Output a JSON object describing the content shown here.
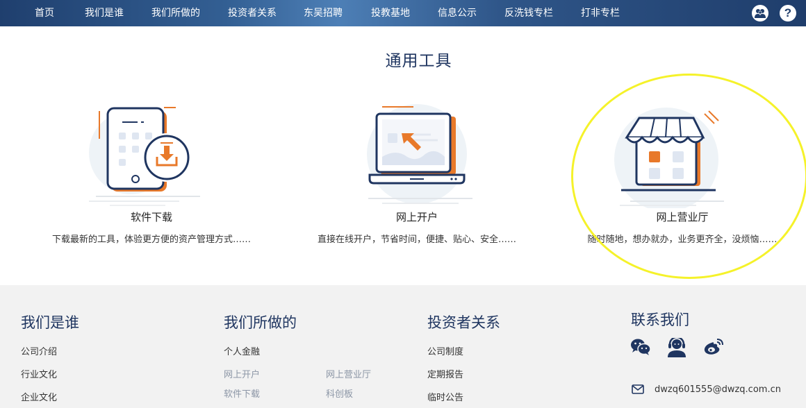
{
  "nav": {
    "items": [
      "首页",
      "我们是谁",
      "我们所做的",
      "投资者关系",
      "东吴招聘",
      "投教基地",
      "信息公示",
      "反洗钱专栏",
      "打非专栏"
    ],
    "user_icon": "user-group-icon",
    "help_icon": "help-icon",
    "help_glyph": "?"
  },
  "tools": {
    "title": "通用工具",
    "items": [
      {
        "name": "软件下载",
        "desc": "下载最新的工具，体验更方便的资产管理方式……",
        "icon": "phone-download-icon"
      },
      {
        "name": "网上开户",
        "desc": "直接在线开户，节省时间，便捷、贴心、安全……",
        "icon": "laptop-cursor-icon"
      },
      {
        "name": "网上营业厅",
        "desc": "随时随地，想办就办，业务更齐全，没烦恼……",
        "icon": "storefront-icon"
      }
    ]
  },
  "footer": {
    "who": {
      "title": "我们是谁",
      "links": [
        "公司介绍",
        "行业文化",
        "企业文化"
      ]
    },
    "what": {
      "title": "我们所做的",
      "section": "个人金融",
      "links_left": [
        "网上开户",
        "软件下载"
      ],
      "links_right": [
        "网上营业厅",
        "科创板"
      ]
    },
    "ir": {
      "title": "投资者关系",
      "links": [
        "公司制度",
        "定期报告",
        "临时公告"
      ]
    },
    "contact": {
      "title": "联系我们",
      "icons": [
        "wechat-icon",
        "customer-service-icon",
        "weibo-icon"
      ],
      "email": "dwzq601555@dwzq.com.cn"
    }
  },
  "colors": {
    "nav_start": "#1f3f6e",
    "nav_mid": "#4d7fb6",
    "accent_orange": "#e8792a",
    "navy": "#1f3560",
    "highlight": "#f5f22a",
    "footer_bg": "#f2f2f2"
  }
}
